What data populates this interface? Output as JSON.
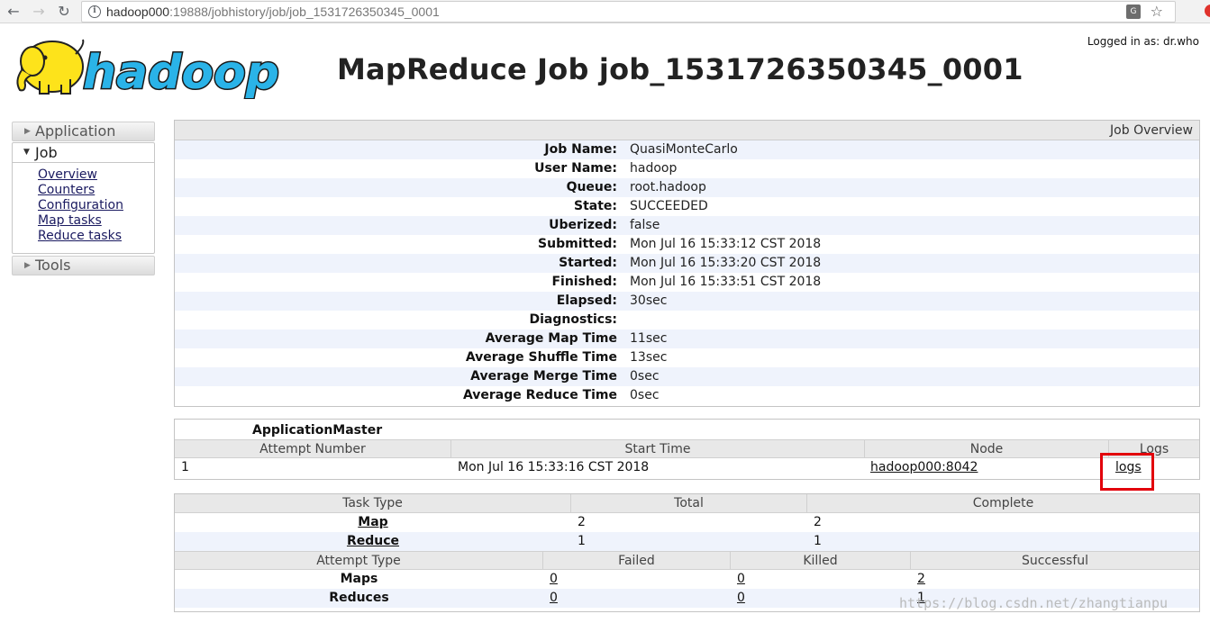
{
  "browser": {
    "url_host": "hadoop000",
    "url_path": ":19888/jobhistory/job/job_1531726350345_0001"
  },
  "header": {
    "logged_in": "Logged in as: dr.who",
    "title": "MapReduce Job job_1531726350345_0001",
    "logo_text": "hadoop"
  },
  "sidebar": {
    "application": "Application",
    "job": "Job",
    "job_links": [
      "Overview",
      "Counters",
      "Configuration",
      "Map tasks",
      "Reduce tasks"
    ],
    "tools": "Tools"
  },
  "overview": {
    "heading": "Job Overview",
    "rows": [
      {
        "k": "Job Name:",
        "v": "QuasiMonteCarlo"
      },
      {
        "k": "User Name:",
        "v": "hadoop"
      },
      {
        "k": "Queue:",
        "v": "root.hadoop"
      },
      {
        "k": "State:",
        "v": "SUCCEEDED"
      },
      {
        "k": "Uberized:",
        "v": "false"
      },
      {
        "k": "Submitted:",
        "v": "Mon Jul 16 15:33:12 CST 2018"
      },
      {
        "k": "Started:",
        "v": "Mon Jul 16 15:33:20 CST 2018"
      },
      {
        "k": "Finished:",
        "v": "Mon Jul 16 15:33:51 CST 2018"
      },
      {
        "k": "Elapsed:",
        "v": "30sec"
      },
      {
        "k": "Diagnostics:",
        "v": ""
      },
      {
        "k": "Average Map Time",
        "v": "11sec"
      },
      {
        "k": "Average Shuffle Time",
        "v": "13sec"
      },
      {
        "k": "Average Merge Time",
        "v": "0sec"
      },
      {
        "k": "Average Reduce Time",
        "v": "0sec"
      }
    ]
  },
  "app_master": {
    "caption": "ApplicationMaster",
    "headers": [
      "Attempt Number",
      "Start Time",
      "Node",
      "Logs"
    ],
    "row": {
      "attempt": "1",
      "start": "Mon Jul 16 15:33:16 CST 2018",
      "node": "hadoop000:8042",
      "logs": "logs"
    }
  },
  "tasks": {
    "headers": [
      "Task Type",
      "Total",
      "Complete"
    ],
    "rows": [
      {
        "type": "Map",
        "total": "2",
        "complete": "2"
      },
      {
        "type": "Reduce",
        "total": "1",
        "complete": "1"
      }
    ],
    "attempt_headers": [
      "Attempt Type",
      "Failed",
      "Killed",
      "Successful"
    ],
    "attempt_rows": [
      {
        "type": "Maps",
        "failed": "0",
        "killed": "0",
        "successful": "2"
      },
      {
        "type": "Reduces",
        "failed": "0",
        "killed": "0",
        "successful": "1"
      }
    ]
  },
  "watermark": "https://blog.csdn.net/zhangtianpu",
  "highlight_color": "#e2000b"
}
